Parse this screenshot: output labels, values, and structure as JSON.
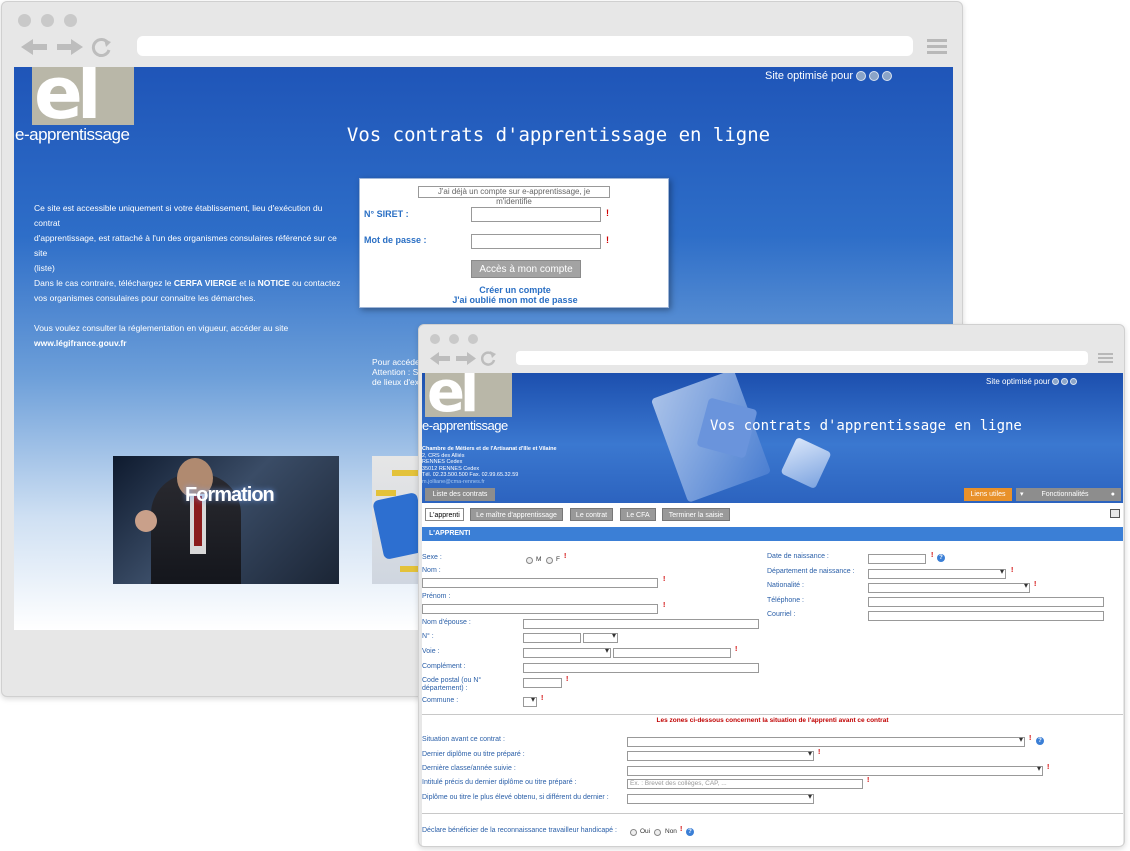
{
  "window1": {
    "site_optimise": "Site optimisé pour",
    "logo_letters": "el",
    "logo_text": "e-apprentissage",
    "title": "Vos contrats d'apprentissage en ligne",
    "intro": {
      "line1": "Ce site est accessible uniquement si votre établissement, lieu d'exécution du contrat",
      "line2": "d'apprentissage, est rattaché à l'un des organismes consulaires référencé sur ce site",
      "line3": "(liste)",
      "line4_pre": "Dans le cas contraire, téléchargez le ",
      "cerfa": "CERFA VIERGE",
      "line4_mid": " et la ",
      "notice": "NOTICE",
      "line4_post": " ou contactez",
      "line5": "vos organismes consulaires pour connaitre les démarches.",
      "line6": "Vous voulez consulter la réglementation en vigueur, accéder au site",
      "legifrance": "www.légifrance.gouv.fr"
    },
    "login": {
      "header": "J'ai déjà un compte sur e-apprentissage, je m'identifie",
      "siret_label": "N° SIRET :",
      "password_label": "Mot de passe :",
      "required": "!",
      "submit": "Accès à mon compte",
      "create": "Créer un compte",
      "forgot": "J'ai oublié mon mot de passe"
    },
    "access_text": {
      "line1": "Pour accéde",
      "line2": "Attention : Si",
      "line3": "de lieux d'ex"
    },
    "formation_word": "Formation"
  },
  "window2": {
    "site_optimise": "Site optimisé pour",
    "logo_letters": "el",
    "logo_text": "e-apprentissage",
    "title": "Vos contrats d'apprentissage en ligne",
    "cma": {
      "name": "Chambre de Métiers et de l'Artisanat d'Ille et Vilaine",
      "address1": "2, CRS des Alliés",
      "address2": "RENNES Cedex",
      "address3": "35012 RENNES Cedex",
      "phone": "Tél. 02.23.500.500 Fax. 02.99.65.32.59",
      "email": "m.jolliane@cma-rennes.fr"
    },
    "top_tabs": {
      "list": "Liste des contrats",
      "links": "Liens utiles",
      "features": "Fonctionnalités"
    },
    "tabs": [
      "L'apprenti",
      "Le maître d'apprentissage",
      "Le contrat",
      "Le CFA",
      "Terminer la saisie"
    ],
    "section": "L'APPRENTI",
    "left_fields": {
      "sexe": "Sexe :",
      "sexe_m": "M",
      "sexe_f": "F",
      "nom": "Nom :",
      "prenom": "Prénom :",
      "nom_epouse": "Nom d'épouse :",
      "numero": "N° :",
      "voie": "Voie :",
      "complement": "Complément :",
      "code_postal": "Code postal (ou N° département) :",
      "commune": "Commune :"
    },
    "right_fields": {
      "naissance": "Date de naissance :",
      "dept_naissance": "Département de naissance :",
      "nationalite": "Nationalité :",
      "telephone": "Téléphone :",
      "courriel": "Courriel :"
    },
    "notice": "Les zones ci-dessous concernent la situation de l'apprenti avant ce contrat",
    "situation": {
      "avant": "Situation avant ce contrat :",
      "dernier_diplome": "Dernier diplôme ou titre préparé :",
      "derniere_classe": "Dernière classe/année suivie :",
      "intitule": "Intitulé précis du dernier diplôme ou titre préparé :",
      "intitule_placeholder": "Ex. : Brevet des collèges, CAP, ...",
      "plus_eleve": "Diplôme ou titre le plus élevé obtenu, si différent du dernier :",
      "handicap": "Déclare bénéficier de la reconnaissance travailleur handicapé :",
      "oui": "Oui",
      "non": "Non"
    },
    "required": "!",
    "help": "?"
  },
  "colors": {
    "blue_header": "#1f55b8",
    "link_blue": "#2a6fc4",
    "required_red": "#d00000",
    "section_blue": "#3b7fd6",
    "orange_tab": "#e8912a"
  }
}
